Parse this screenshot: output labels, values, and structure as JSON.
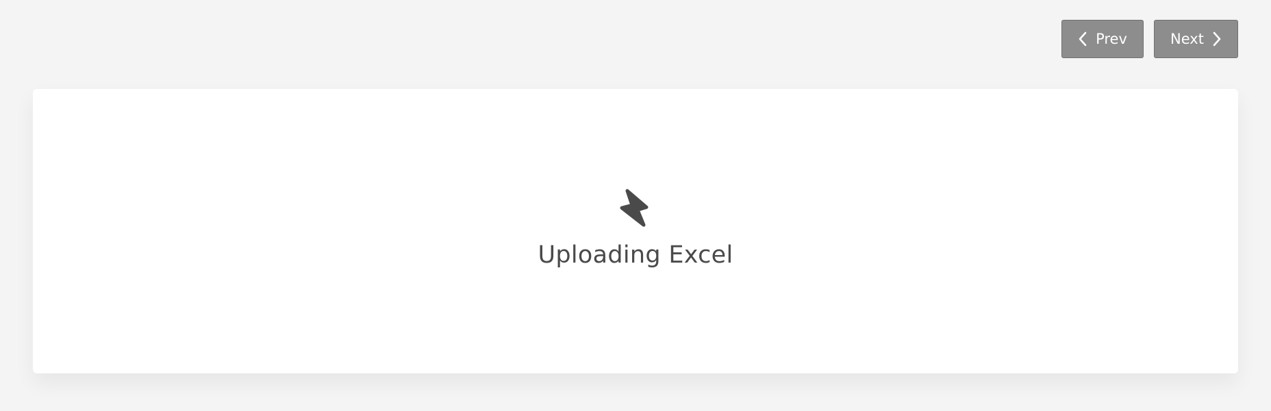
{
  "nav": {
    "prev_label": "Prev",
    "next_label": "Next",
    "prev_icon": "chevron-left-icon",
    "next_icon": "chevron-right-icon"
  },
  "status": {
    "icon": "lightning-bolt-icon",
    "text": "Uploading Excel"
  },
  "colors": {
    "background": "#f4f4f4",
    "card": "#ffffff",
    "button": "#8d8d8d",
    "button_text": "#ffffff",
    "status_text": "#4a4a4a",
    "icon": "#4a4a4a"
  }
}
